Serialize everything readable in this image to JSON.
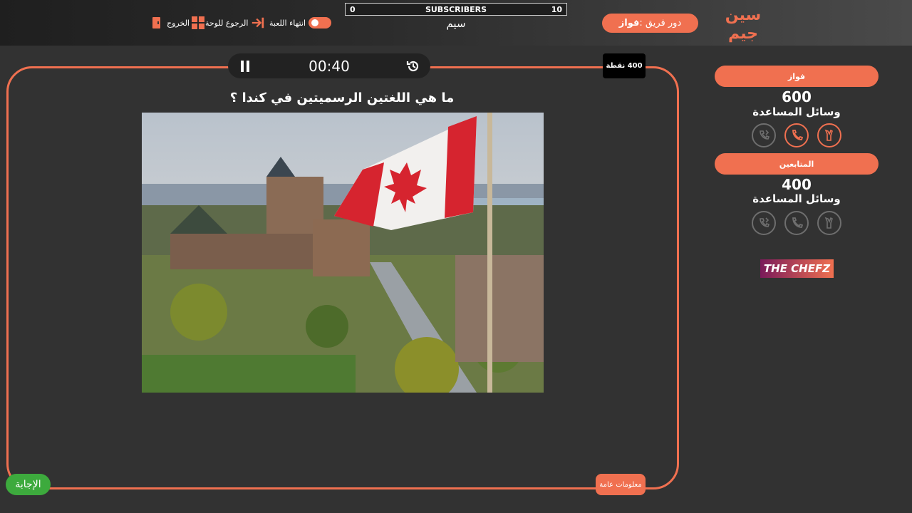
{
  "header": {
    "logo_text": "سين جيم",
    "turn_label": "دور فريق : ",
    "turn_team": "فواز",
    "subscribers": {
      "left_value": "0",
      "title": "SUBSCRIBERS",
      "right_value": "10"
    },
    "game_name": "سيم",
    "end_game_label": "انتهاء اللعبة",
    "back_to_board_label": "الرجوع للوحة",
    "exit_label": "الخروج"
  },
  "timer": {
    "time": "00:40"
  },
  "points_badge": "400 نقطة",
  "question": "ما هي اللغتين الرسميتين في كندا ؟",
  "answer_button": "الإجابة",
  "info_button": "معلومات عامة",
  "teams": [
    {
      "name": "فواز",
      "score": "600",
      "help_label": "وسائل المساعدة",
      "lifelines": [
        "call-switch",
        "phone",
        "two-answers"
      ],
      "active": [
        false,
        true,
        true
      ]
    },
    {
      "name": "المتابعين",
      "score": "400",
      "help_label": "وسائل المساعدة",
      "lifelines": [
        "call-switch",
        "phone",
        "two-answers"
      ],
      "active": [
        false,
        false,
        false
      ]
    }
  ],
  "sponsor": "THE CHEFZ",
  "colors": {
    "accent": "#f07050",
    "answer_green": "#3daa3d",
    "background": "#323232"
  }
}
